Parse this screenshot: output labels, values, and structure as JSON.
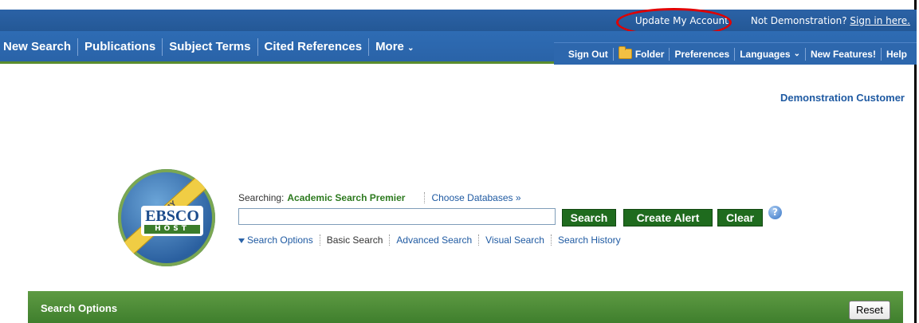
{
  "header": {
    "update_account": "Update My Account",
    "not_demo": "Not Demonstration?",
    "sign_in": "Sign in here."
  },
  "nav": {
    "left": [
      "New Search",
      "Publications",
      "Subject Terms",
      "Cited References",
      "More"
    ],
    "more_chevron": "⌄",
    "right": {
      "sign_out": "Sign Out",
      "folder": "Folder",
      "preferences": "Preferences",
      "languages": "Languages",
      "new_features": "New Features!",
      "help": "Help"
    }
  },
  "customer": "Demonstration Customer",
  "logo": {
    "ribbon": "MY",
    "name": "EBSCO",
    "sub": "HOST"
  },
  "search": {
    "searching_label": "Searching:",
    "database": "Academic Search Premier",
    "choose_databases": "Choose Databases »",
    "input_value": "",
    "search_button": "Search",
    "create_alert_button": "Create Alert",
    "clear_button": "Clear",
    "help_glyph": "?"
  },
  "links": {
    "search_options": "Search Options",
    "basic_search": "Basic Search",
    "advanced_search": "Advanced Search",
    "visual_search": "Visual Search",
    "search_history": "Search History"
  },
  "options_panel": {
    "title": "Search Options",
    "reset": "Reset"
  },
  "colors": {
    "nav_blue": "#2a63a8",
    "brand_green": "#1f6b1e",
    "highlight_red": "#e00000"
  }
}
